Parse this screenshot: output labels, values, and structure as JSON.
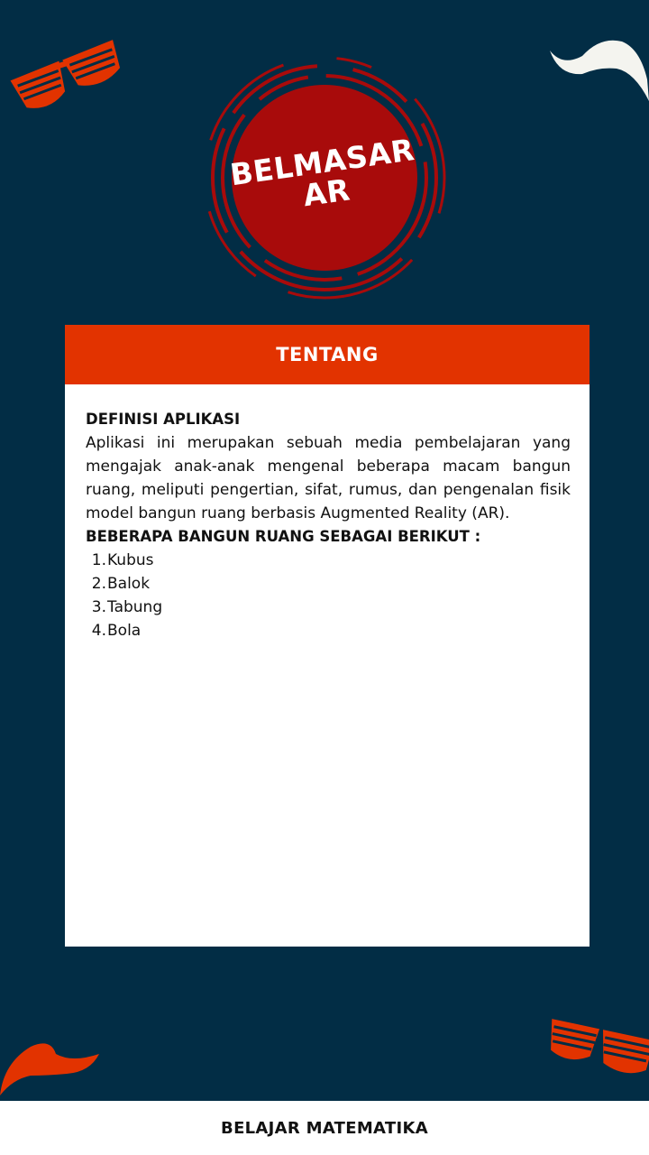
{
  "logo": {
    "line1": "BELMASAR",
    "line2": "AR"
  },
  "card": {
    "header": "TENTANG",
    "definition_heading": "DEFINISI APLIKASI",
    "definition_text": "Aplikasi ini merupakan sebuah media pembelajaran yang mengajak anak-anak mengenal beberapa macam bangun ruang, meliputi pengertian, sifat, rumus, dan pengenalan fisik model bangun ruang berbasis Augmented Reality (AR).",
    "list_heading": "BEBERAPA BANGUN RUANG SEBAGAI BERIKUT :",
    "items": [
      {
        "num": "1.",
        "label": "Kubus"
      },
      {
        "num": "2.",
        "label": "Balok"
      },
      {
        "num": "3.",
        "label": "Tabung"
      },
      {
        "num": "4.",
        "label": "Bola"
      }
    ]
  },
  "footer": {
    "label": "BELAJAR MATEMATIKA"
  },
  "colors": {
    "background": "#022d45",
    "accent": "#e23300",
    "logo_red": "#a80b0b",
    "white": "#ffffff"
  },
  "icons": [
    "party-glasses-icon",
    "mustache-icon",
    "mustache-icon",
    "party-glasses-icon"
  ]
}
